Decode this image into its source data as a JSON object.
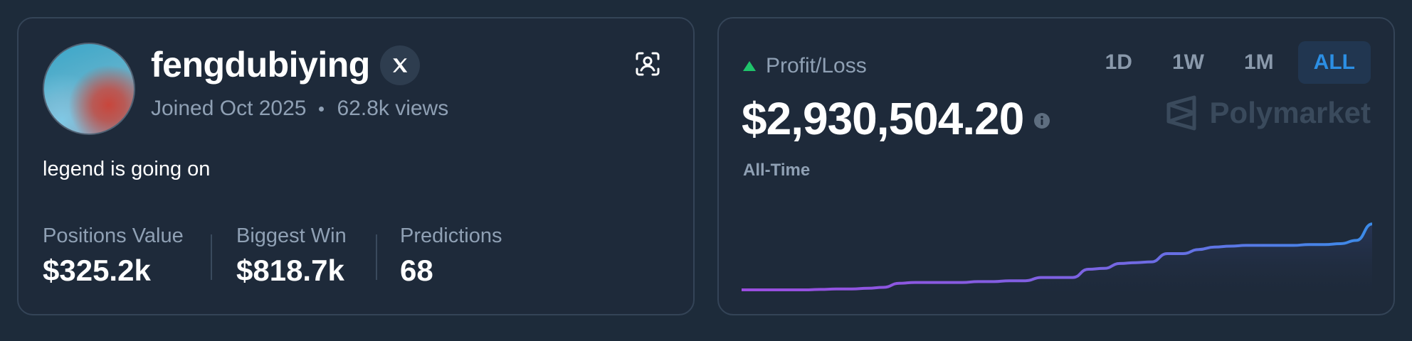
{
  "profile": {
    "username": "fengdubiying",
    "joined": "Joined Oct 2025",
    "views": "62.8k views",
    "bio": "legend is going on",
    "icons": {
      "social": "x-logo-icon",
      "share": "scan-user-icon"
    },
    "stats": [
      {
        "label": "Positions Value",
        "value": "$325.2k"
      },
      {
        "label": "Biggest Win",
        "value": "$818.7k"
      },
      {
        "label": "Predictions",
        "value": "68"
      }
    ]
  },
  "pnl": {
    "title": "Profit/Loss",
    "amount": "$2,930,504.20",
    "period_label": "All-Time",
    "brand": "Polymarket",
    "tabs": [
      {
        "label": "1D",
        "active": false
      },
      {
        "label": "1W",
        "active": false
      },
      {
        "label": "1M",
        "active": false
      },
      {
        "label": "ALL",
        "active": true
      }
    ],
    "colors": {
      "positive": "#1fc46b",
      "accent": "#2c8fe4",
      "line_start": "#9b4de0",
      "line_end": "#3b8be8"
    }
  },
  "chart_data": {
    "type": "area",
    "x": [
      0,
      1,
      2,
      3,
      4,
      5,
      6,
      7,
      8,
      9,
      10,
      11,
      12,
      13,
      14,
      15,
      16,
      17,
      18,
      19,
      20,
      21,
      22,
      23,
      24,
      25,
      26,
      27,
      28,
      29,
      30,
      31,
      32,
      33,
      34,
      35,
      36,
      37,
      38,
      39,
      40
    ],
    "values": [
      0,
      0,
      0,
      0,
      0,
      0.5,
      1,
      1,
      2,
      3,
      8,
      9,
      9,
      9,
      9,
      10,
      10,
      11,
      11,
      15,
      15,
      15,
      25,
      26,
      32,
      33,
      34,
      44,
      44,
      49,
      52,
      53,
      54,
      54,
      54,
      54,
      55,
      55,
      56,
      60,
      80
    ],
    "ylim": [
      0,
      100
    ]
  }
}
